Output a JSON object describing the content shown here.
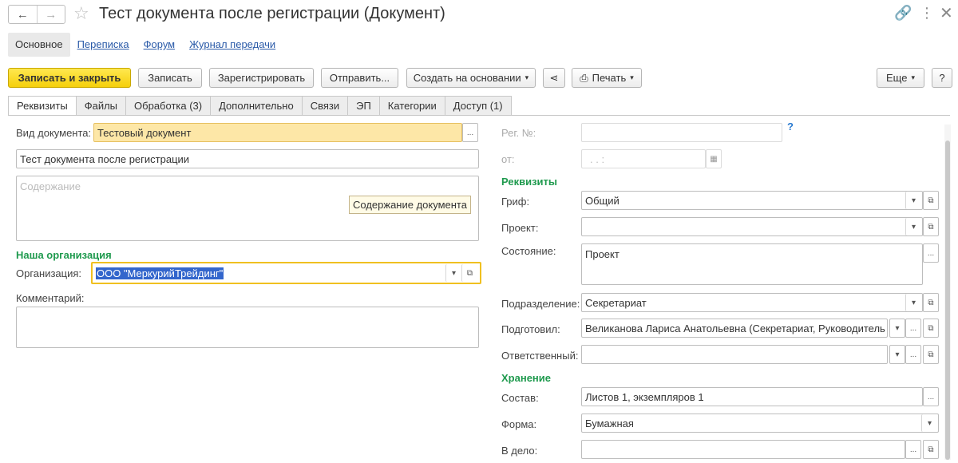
{
  "window": {
    "title": "Тест документа после регистрации (Документ)"
  },
  "navlinks": {
    "main": "Основное",
    "correspondence": "Переписка",
    "forum": "Форум",
    "transfer_log": "Журнал передачи"
  },
  "toolbar": {
    "save_close": "Записать и закрыть",
    "save": "Записать",
    "register": "Зарегистрировать",
    "send": "Отправить...",
    "create_basis": "Создать на основании",
    "print": "Печать",
    "more": "Еще",
    "help": "?"
  },
  "tabs": [
    "Реквизиты",
    "Файлы",
    "Обработка (3)",
    "Дополнительно",
    "Связи",
    "ЭП",
    "Категории",
    "Доступ (1)"
  ],
  "left": {
    "doc_type_label": "Вид документа:",
    "doc_type_value": "Тестовый документ",
    "title_value": "Тест документа после регистрации",
    "content_placeholder": "Содержание",
    "content_tooltip": "Содержание документа",
    "org_heading": "Наша организация",
    "org_label": "Организация:",
    "org_value": "ООО \"МеркурийТрейдинг\"",
    "comment_label": "Комментарий:"
  },
  "right": {
    "reg_no_label": "Рег. №:",
    "reg_no_value": "",
    "help_mark": "?",
    "date_label": "от:",
    "date_value": ". .      :",
    "requisites_heading": "Реквизиты",
    "grif_label": "Гриф:",
    "grif_value": "Общий",
    "project_label": "Проект:",
    "project_value": "",
    "state_label": "Состояние:",
    "state_value": "Проект",
    "dept_label": "Подразделение:",
    "dept_value": "Секретариат",
    "prepared_label": "Подготовил:",
    "prepared_value": "Великанова Лариса Анатольевна (Секретариат, Руководитель отд",
    "responsible_label": "Ответственный:",
    "responsible_value": "",
    "storage_heading": "Хранение",
    "composition_label": "Состав:",
    "composition_value": "Листов 1, экземпляров 1",
    "form_label": "Форма:",
    "form_value": "Бумажная",
    "case_label": "В дело:",
    "case_value": ""
  },
  "icons": {
    "back": "←",
    "forward": "→",
    "star": "☆",
    "link": "🔗",
    "menu": "⋮",
    "close": "✕",
    "share": "⋖",
    "printer": "⎙",
    "dropdown": "▾",
    "ellipsis": "...",
    "open": "⧉",
    "calendar": "▦"
  }
}
